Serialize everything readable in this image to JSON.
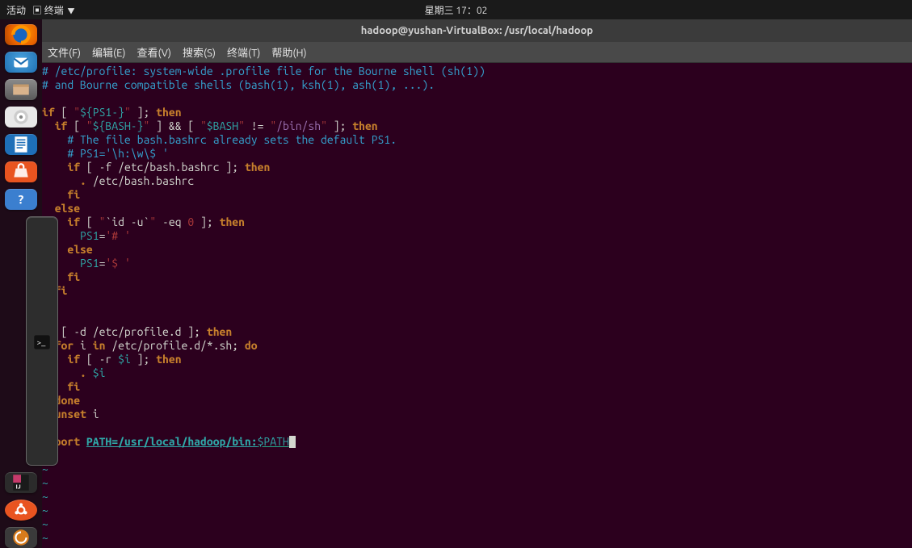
{
  "topbar": {
    "activities": "活动",
    "appmenu": "终端",
    "clock": "星期三 17：02"
  },
  "window": {
    "title": "hadoop@yushan-VirtualBox: /usr/local/hadoop"
  },
  "menubar": {
    "file": "文件(F)",
    "edit": "编辑(E)",
    "view": "查看(V)",
    "search": "搜索(S)",
    "terminal": "终端(T)",
    "help": "帮助(H)"
  },
  "dock": {
    "firefox": "firefox-icon",
    "thunderbird": "thunderbird-icon",
    "files": "files-icon",
    "rhythmbox": "rhythmbox-icon",
    "writer": "libreoffice-writer-icon",
    "software": "software-center-icon",
    "help": "help-icon",
    "terminal": "terminal-icon",
    "intellij": "intellij-icon",
    "ubuntu": "show-applications-icon",
    "updater": "software-updater-icon"
  },
  "file": {
    "c1": "# /etc/profile: system-wide .profile file for the Bourne shell (sh(1))",
    "c2": "# and Bourne compatible shells (bash(1), ksh(1), ash(1), ...).",
    "kw_if": "if",
    "kw_then": "then",
    "kw_else": "else",
    "kw_fi": "fi",
    "kw_for": "for",
    "kw_in": "in",
    "kw_do": "do",
    "kw_done": "done",
    "kw_unset": "unset",
    "kw_export": "export",
    "kw_dot": ".",
    "ps1_var": "${PS1-}",
    "bash_var": "${BASH-}",
    "bash_dollar": "$BASH",
    "binsh": "/bin/sh",
    "c3": "# The file bash.bashrc already sets the default PS1.",
    "c4": "# PS1='\\h:\\w\\$ '",
    "bashrc_path": "/etc/bash.bashrc",
    "id_cmd": "`id -u`",
    "eq": "-eq",
    "zero": "0",
    "ps1": "PS1",
    "hash_prompt": "'# '",
    "dollar_prompt": "'$ '",
    "profile_d": "/etc/profile.d",
    "profile_glob": "/etc/profile.d/*.sh",
    "i_var": "$i",
    "i_name": "i",
    "path_lhs": "PATH=/usr/local/hadoop/bin:",
    "path_rhs": "$PATH",
    "tilde": "~"
  }
}
